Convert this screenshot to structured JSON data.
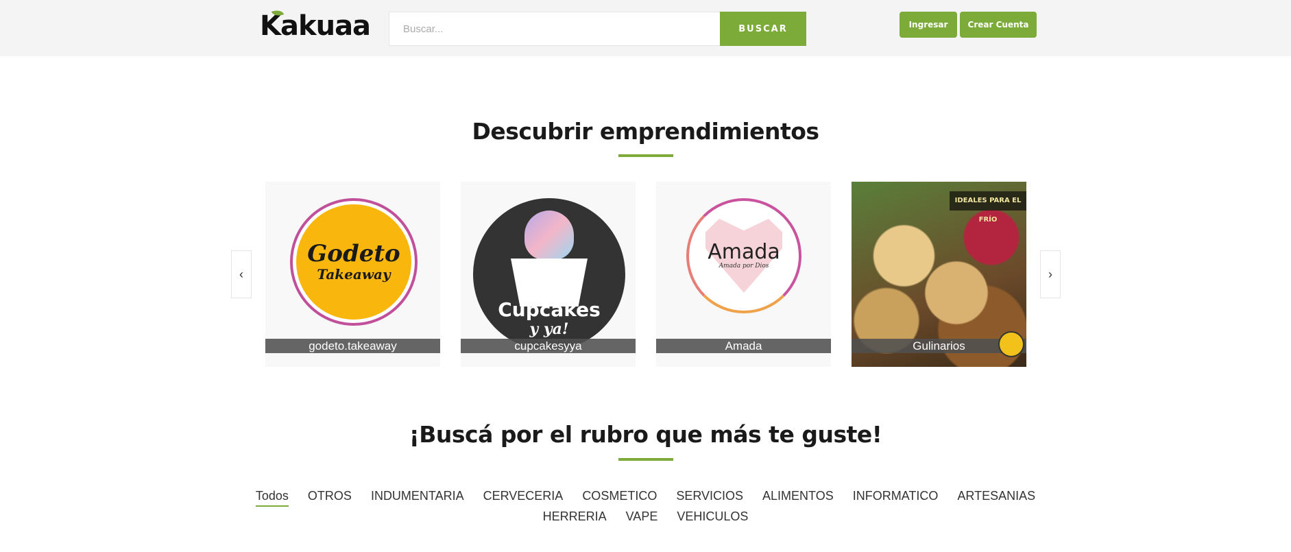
{
  "header": {
    "logo_text": "Kakuaa",
    "search_placeholder": "Buscar...",
    "search_button": "BUSCAR",
    "login_button": "Ingresar",
    "create_account_button": "Crear Cuenta"
  },
  "featured": {
    "title": "Descubrir emprendimientos",
    "prev_icon": "chevron-left-icon",
    "next_icon": "chevron-right-icon",
    "prev_symbol": "‹",
    "next_symbol": "›",
    "cards": [
      {
        "name": "godeto.takeaway",
        "logo_line1": "Godeto",
        "logo_line2": "Takeaway"
      },
      {
        "name": "cupcakesyya",
        "logo_line1": "Cupcakes",
        "logo_line2": "y ya!"
      },
      {
        "name": "Amada",
        "logo_line1": "Amada",
        "logo_line2": "Amada por Dios"
      },
      {
        "name": "Gulinarios",
        "banner": "IDEALES PARA EL FRÍO"
      }
    ]
  },
  "categories_section": {
    "title": "¡Buscá por el rubro que más te guste!",
    "row1": [
      "Todos",
      "OTROS",
      "INDUMENTARIA",
      "CERVECERIA",
      "COSMETICO",
      "SERVICIOS",
      "ALIMENTOS",
      "INFORMATICO",
      "ARTESANIAS"
    ],
    "row2": [
      "HERRERIA",
      "VAPE",
      "VEHICULOS"
    ],
    "active": "Todos"
  },
  "colors": {
    "accent": "#7cab3a",
    "header_bg": "#f4f4f4",
    "caption_bg": "#505050"
  }
}
